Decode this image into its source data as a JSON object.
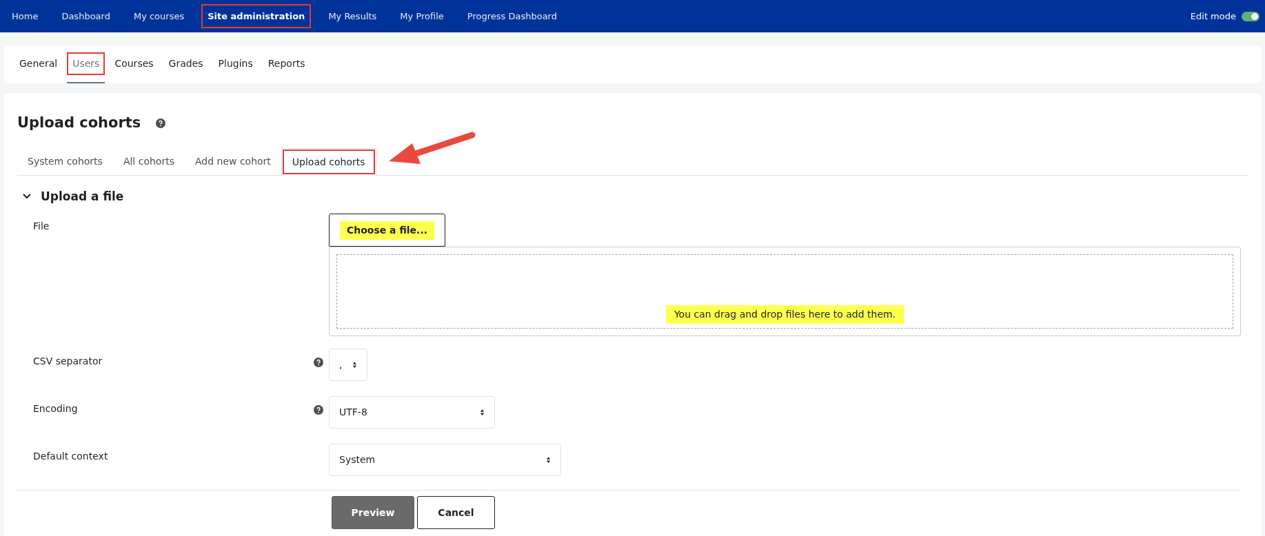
{
  "top_nav": {
    "items": [
      {
        "label": "Home",
        "selected": false,
        "highlighted": false
      },
      {
        "label": "Dashboard",
        "selected": false,
        "highlighted": false
      },
      {
        "label": "My courses",
        "selected": false,
        "highlighted": false
      },
      {
        "label": "Site administration",
        "selected": true,
        "highlighted": true
      },
      {
        "label": "My Results",
        "selected": false,
        "highlighted": false
      },
      {
        "label": "My Profile",
        "selected": false,
        "highlighted": false
      },
      {
        "label": "Progress Dashboard",
        "selected": false,
        "highlighted": false
      }
    ],
    "edit_mode": {
      "label": "Edit mode",
      "on": true
    }
  },
  "secondary_nav": {
    "items": [
      {
        "label": "General",
        "selected": false,
        "highlighted": false
      },
      {
        "label": "Users",
        "selected": true,
        "highlighted": true
      },
      {
        "label": "Courses",
        "selected": false,
        "highlighted": false
      },
      {
        "label": "Grades",
        "selected": false,
        "highlighted": false
      },
      {
        "label": "Plugins",
        "selected": false,
        "highlighted": false
      },
      {
        "label": "Reports",
        "selected": false,
        "highlighted": false
      }
    ]
  },
  "page": {
    "title": "Upload cohorts",
    "tabs": [
      {
        "label": "System cohorts",
        "selected": false,
        "highlighted": false
      },
      {
        "label": "All cohorts",
        "selected": false,
        "highlighted": false
      },
      {
        "label": "Add new cohort",
        "selected": false,
        "highlighted": false
      },
      {
        "label": "Upload cohorts",
        "selected": true,
        "highlighted": true
      }
    ],
    "section": {
      "title": "Upload a file",
      "expanded": true
    },
    "fields": [
      {
        "kind": "file",
        "label": "File",
        "button": "Choose a file...",
        "button_highlighted": true,
        "drop_hint": "You can drag and drop files here to add them.",
        "drop_hint_highlighted": true,
        "help": false
      },
      {
        "kind": "select",
        "label": "CSV separator",
        "value": ",",
        "help": true
      },
      {
        "kind": "select",
        "label": "Encoding",
        "value": "UTF-8",
        "help": true
      },
      {
        "kind": "select",
        "label": "Default context",
        "value": "System",
        "help": false
      }
    ],
    "buttons": [
      {
        "label": "Preview",
        "kind": "primary"
      },
      {
        "label": "Cancel",
        "kind": "secondary"
      }
    ]
  }
}
